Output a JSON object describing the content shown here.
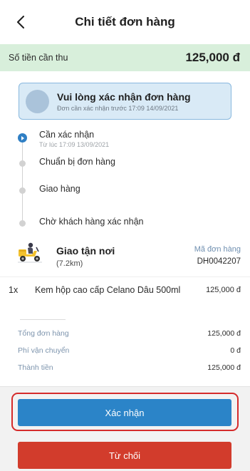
{
  "header": {
    "title": "Chi tiết đơn hàng",
    "back_icon": "chevron-left-icon"
  },
  "amount": {
    "label": "Số tiền cần thu",
    "value": "125,000 đ"
  },
  "confirm_card": {
    "title": "Vui lòng xác nhận đơn hàng",
    "subtitle": "Đơn cần xác nhận trước 17:09 14/09/2021"
  },
  "timeline": {
    "steps": [
      {
        "label": "Cần xác nhận",
        "sub": "Từ lúc 17:09 13/09/2021",
        "active": true
      },
      {
        "label": "Chuẩn bị đơn hàng",
        "sub": "",
        "active": false
      },
      {
        "label": "Giao hàng",
        "sub": "",
        "active": false
      },
      {
        "label": "Chờ khách hàng xác nhận",
        "sub": "",
        "active": false
      }
    ]
  },
  "delivery": {
    "title": "Giao tận nơi",
    "distance": "(7.2km)",
    "order_code_label": "Mã đơn hàng",
    "order_code": "DH0042207",
    "icon": "delivery-scooter-icon"
  },
  "items": [
    {
      "qty": "1x",
      "name": "Kem hộp cao cấp Celano Dâu 500ml",
      "price": "125,000 đ"
    }
  ],
  "summary": {
    "rows": [
      {
        "label": "Tổng đơn hàng",
        "value": "125,000 đ"
      },
      {
        "label": "Phí vận chuyển",
        "value": "0 đ"
      },
      {
        "label": "Thành tiền",
        "value": "125,000 đ"
      }
    ]
  },
  "actions": {
    "confirm_label": "Xác nhận",
    "reject_label": "Từ chối"
  },
  "colors": {
    "primary": "#2b84c8",
    "danger": "#d23c2c",
    "amount_bg": "#d8efdb",
    "card_bg": "#d9eaf6",
    "highlight": "#d52b2b"
  }
}
